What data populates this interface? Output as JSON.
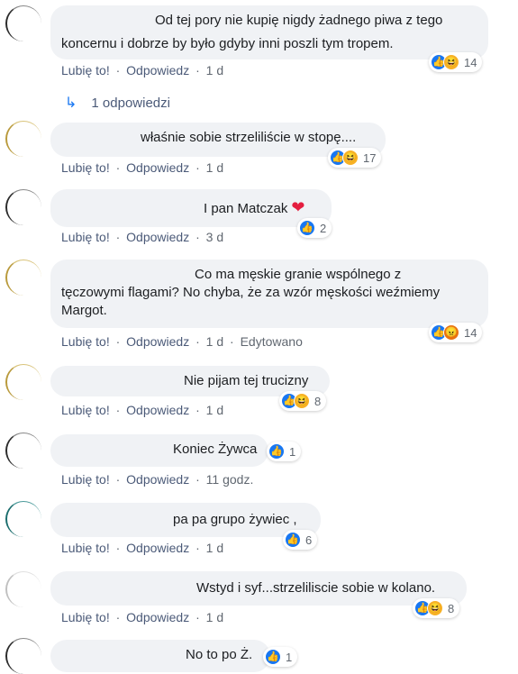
{
  "comments": [
    {
      "text": "Od tej pory nie kupię nigdy żadnego piwa z tego koncernu i dobrze by było gdyby inni poszli tym tropem.",
      "line1": "Od tej pory nie kupię nigdy żadnego piwa z tego",
      "line2": "koncernu i dobrze by było gdyby inni poszli tym tropem.",
      "like": "Lubię to!",
      "reply": "Odpowiedz",
      "time": "1 d",
      "reactions": "14"
    },
    {
      "text": "właśnie sobie strzeliliście w stopę....",
      "like": "Lubię to!",
      "reply": "Odpowiedz",
      "time": "1 d",
      "reactions": "17"
    },
    {
      "text": "I pan Matczak",
      "like": "Lubię to!",
      "reply": "Odpowiedz",
      "time": "3 d",
      "reactions": "2"
    },
    {
      "line1": "Co ma męskie granie wspólnego z",
      "line2": "tęczowymi flagami? No chyba, że za wzór męskości weźmiemy",
      "line3": "Margot.",
      "like": "Lubię to!",
      "reply": "Odpowiedz",
      "time": "1 d",
      "edited": "Edytowano",
      "reactions": "14"
    },
    {
      "text": "Nie pijam tej trucizny",
      "like": "Lubię to!",
      "reply": "Odpowiedz",
      "time": "1 d",
      "reactions": "8"
    },
    {
      "text": "Koniec Żywca",
      "like": "Lubię to!",
      "reply": "Odpowiedz",
      "time": "11 godz.",
      "reactions": "1"
    },
    {
      "text": "pa pa grupo żywiec ,",
      "like": "Lubię to!",
      "reply": "Odpowiedz",
      "time": "1 d",
      "reactions": "6"
    },
    {
      "text": "Wstyd i syf...strzeliliscie sobie w kolano.",
      "like": "Lubię to!",
      "reply": "Odpowiedz",
      "time": "1 d",
      "reactions": "8"
    },
    {
      "text": "No to po Ż.",
      "reactions": "1"
    }
  ],
  "replies_link": "1 odpowiedzi",
  "sep": "·",
  "icons": {
    "like": "thumbs-up-icon",
    "haha": "haha-icon",
    "angry": "angry-icon",
    "heart": "heart-icon",
    "reply_arrow": "reply-arrow-icon"
  },
  "colors": {
    "like": "#1877f2",
    "haha": "#f7b125",
    "angry": "#e9710f",
    "heart": "#e41e3f",
    "link": "#4b5a78",
    "bubble": "#f0f2f5"
  }
}
